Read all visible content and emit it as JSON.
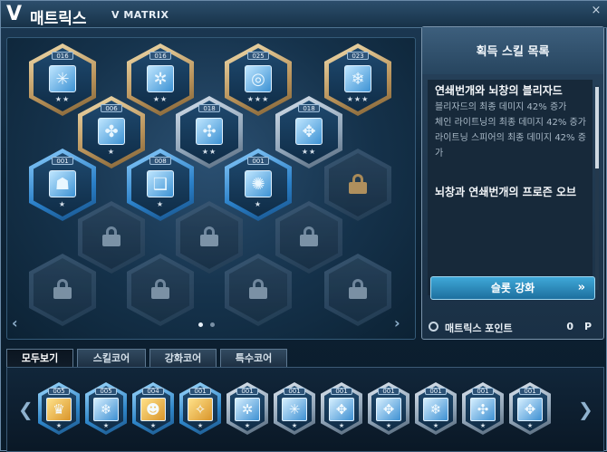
{
  "window": {
    "title_prefix": "V",
    "title": "매트릭스",
    "title_en": "V MATRIX",
    "close_icon": "×"
  },
  "matrix": {
    "prev_arrow": "‹",
    "next_arrow": "›",
    "page_count": 2,
    "current_page": 1,
    "slots": [
      {
        "kind": "core",
        "frame": "gold",
        "level": "016",
        "icon": "ice-cross-icon",
        "glyph": "✳",
        "stars": "★★"
      },
      {
        "kind": "core",
        "frame": "gold",
        "level": "016",
        "icon": "ice-dash-icon",
        "glyph": "✲",
        "stars": "★★"
      },
      {
        "kind": "core",
        "frame": "gold",
        "level": "025",
        "icon": "ice-ring-icon",
        "glyph": "◎",
        "stars": "★★★"
      },
      {
        "kind": "core",
        "frame": "gold",
        "level": "023",
        "icon": "ice-spirit-icon",
        "glyph": "❄",
        "stars": "★★★"
      },
      {
        "kind": "core",
        "frame": "gold",
        "level": "006",
        "icon": "ice-shield-icon",
        "glyph": "✤",
        "stars": "★"
      },
      {
        "kind": "core",
        "frame": "silver",
        "level": "018",
        "icon": "ice-shard-icon",
        "glyph": "✣",
        "stars": "★★"
      },
      {
        "kind": "core",
        "frame": "silver",
        "level": "018",
        "icon": "ice-branch-icon",
        "glyph": "✥",
        "stars": "★★"
      },
      {
        "kind": "core",
        "frame": "blue",
        "level": "001",
        "icon": "golem-icon",
        "glyph": "☗",
        "stars": "★"
      },
      {
        "kind": "core",
        "frame": "blue",
        "level": "008",
        "icon": "book-icon",
        "glyph": "❑",
        "stars": "★"
      },
      {
        "kind": "core",
        "frame": "blue",
        "level": "001",
        "icon": "sun-core-icon",
        "glyph": "✺",
        "stars": "★"
      },
      {
        "kind": "lock",
        "frame": "goldlock"
      },
      {
        "kind": "lock",
        "frame": "lock"
      },
      {
        "kind": "lock",
        "frame": "lock"
      },
      {
        "kind": "lock",
        "frame": "lock"
      },
      {
        "kind": "lock",
        "frame": "lock"
      },
      {
        "kind": "lock",
        "frame": "lock"
      },
      {
        "kind": "lock",
        "frame": "lock"
      },
      {
        "kind": "lock",
        "frame": "lock"
      }
    ]
  },
  "panel": {
    "title": "획득 스킬 목록",
    "skills": [
      {
        "name": "연쇄번개와 뇌창의 블리자드",
        "desc": [
          "블리자드의 최종 데미지 42% 증가",
          "체인 라이트닝의 최종 데미지 42% 증가",
          "라이트닝 스피어의 최종 데미지 42% 증가"
        ]
      },
      {
        "name": "뇌창과 연쇄번개의 프로즌 오브",
        "desc": []
      }
    ],
    "slot_upgrade_label": "슬롯 강화",
    "slot_upgrade_chevron": "»"
  },
  "points": {
    "label": "매트릭스 포인트",
    "value": "0",
    "unit": "P"
  },
  "tabs": [
    {
      "label": "모두보기",
      "active": true
    },
    {
      "label": "스킬코어",
      "active": false
    },
    {
      "label": "강화코어",
      "active": false
    },
    {
      "label": "특수코어",
      "active": false
    }
  ],
  "core_list": {
    "prev_arrow": "❮",
    "next_arrow": "❯",
    "items": [
      {
        "level": "005",
        "frame": "blue",
        "tone": "gold",
        "icon": "angel-icon",
        "glyph": "♛"
      },
      {
        "level": "005",
        "frame": "blue",
        "tone": "ice",
        "icon": "snowflake-icon",
        "glyph": "❄"
      },
      {
        "level": "004",
        "frame": "blue",
        "tone": "gold",
        "icon": "fairy-icon",
        "glyph": "☻"
      },
      {
        "level": "001",
        "frame": "blue",
        "tone": "gold",
        "icon": "spark-icon",
        "glyph": "✧"
      },
      {
        "level": "001",
        "frame": "silver",
        "tone": "ice",
        "icon": "ice-dash-icon",
        "glyph": "✲"
      },
      {
        "level": "001",
        "frame": "silver",
        "tone": "ice",
        "icon": "ice-cross-icon",
        "glyph": "✳"
      },
      {
        "level": "001",
        "frame": "silver",
        "tone": "ice",
        "icon": "ice-branch-icon",
        "glyph": "✥"
      },
      {
        "level": "001",
        "frame": "silver",
        "tone": "ice",
        "icon": "ice-branch-icon",
        "glyph": "✥"
      },
      {
        "level": "001",
        "frame": "silver",
        "tone": "ice",
        "icon": "ice-spirit-icon",
        "glyph": "❄"
      },
      {
        "level": "001",
        "frame": "silver",
        "tone": "ice",
        "icon": "ice-shard-icon",
        "glyph": "✣"
      },
      {
        "level": "001",
        "frame": "silver",
        "tone": "ice",
        "icon": "ice-branch-icon",
        "glyph": "✥"
      }
    ]
  }
}
